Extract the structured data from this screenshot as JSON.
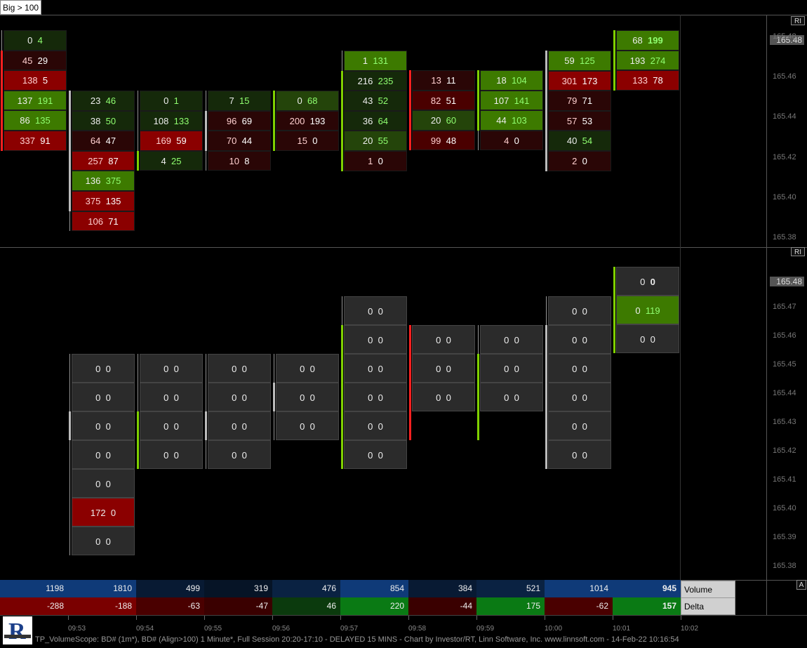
{
  "filter_tag": "Big > 100",
  "top_axis": {
    "ticks": [
      "165.48",
      "165.46",
      "165.44",
      "165.42",
      "165.40",
      "165.38"
    ],
    "ri_label": "RI",
    "price_label": "165.48"
  },
  "bottom_axis": {
    "ticks": [
      "165.47",
      "165.46",
      "165.45",
      "165.44",
      "165.43",
      "165.42",
      "165.41",
      "165.40",
      "165.39",
      "165.38"
    ],
    "ri_label": "RI",
    "price_label": "165.48"
  },
  "top_bars": [
    {
      "time": "09:53",
      "cells": [
        [
          "0",
          "4"
        ],
        [
          "45",
          "29"
        ],
        [
          "138",
          "5"
        ],
        [
          "137",
          "191"
        ],
        [
          "86",
          "135"
        ],
        [
          "337",
          "91"
        ]
      ]
    },
    {
      "time": "09:54",
      "cells": [
        [
          "23",
          "46"
        ],
        [
          "38",
          "50"
        ],
        [
          "64",
          "47"
        ],
        [
          "257",
          "87"
        ],
        [
          "136",
          "375"
        ],
        [
          "375",
          "135"
        ],
        [
          "106",
          "71"
        ]
      ]
    },
    {
      "time": "09:55",
      "cells": [
        [
          "0",
          "1"
        ],
        [
          "108",
          "133"
        ],
        [
          "169",
          "59"
        ],
        [
          "4",
          "25"
        ]
      ]
    },
    {
      "time": "09:56",
      "cells": [
        [
          "7",
          "15"
        ],
        [
          "96",
          "69"
        ],
        [
          "70",
          "44"
        ],
        [
          "10",
          "8"
        ]
      ]
    },
    {
      "time": "09:57",
      "cells": [
        [
          "0",
          "68"
        ],
        [
          "200",
          "193"
        ],
        [
          "15",
          "0"
        ]
      ]
    },
    {
      "time": "09:58",
      "cells": [
        [
          "1",
          "131"
        ],
        [
          "216",
          "235"
        ],
        [
          "43",
          "52"
        ],
        [
          "36",
          "64"
        ],
        [
          "20",
          "55"
        ],
        [
          "1",
          "0"
        ]
      ]
    },
    {
      "time": "09:59",
      "cells": [
        [
          "13",
          "11"
        ],
        [
          "82",
          "51"
        ],
        [
          "20",
          "60"
        ],
        [
          "99",
          "48"
        ]
      ]
    },
    {
      "time": "10:00",
      "cells": [
        [
          "18",
          "104"
        ],
        [
          "107",
          "141"
        ],
        [
          "44",
          "103"
        ],
        [
          "4",
          "0"
        ]
      ]
    },
    {
      "time": "10:01",
      "cells": [
        [
          "59",
          "125"
        ],
        [
          "301",
          "173"
        ],
        [
          "79",
          "71"
        ],
        [
          "57",
          "53"
        ],
        [
          "40",
          "54"
        ],
        [
          "2",
          "0"
        ]
      ]
    },
    {
      "time": "10:02",
      "cells": [
        [
          "68",
          "199"
        ],
        [
          "193",
          "274"
        ],
        [
          "133",
          "78"
        ]
      ]
    }
  ],
  "bottom_bars": [
    {
      "cells": [
        [
          "0",
          "0"
        ],
        [
          "0",
          "0"
        ],
        [
          "0",
          "0"
        ],
        [
          "0",
          "0"
        ],
        [
          "0",
          "0"
        ],
        [
          "172",
          "0"
        ],
        [
          "0",
          "0"
        ]
      ]
    },
    {
      "cells": [
        [
          "0",
          "0"
        ],
        [
          "0",
          "0"
        ],
        [
          "0",
          "0"
        ],
        [
          "0",
          "0"
        ]
      ]
    },
    {
      "cells": [
        [
          "0",
          "0"
        ],
        [
          "0",
          "0"
        ],
        [
          "0",
          "0"
        ],
        [
          "0",
          "0"
        ]
      ]
    },
    {
      "cells": [
        [
          "0",
          "0"
        ],
        [
          "0",
          "0"
        ],
        [
          "0",
          "0"
        ]
      ]
    },
    {
      "cells": [
        [
          "0",
          "0"
        ],
        [
          "0",
          "0"
        ],
        [
          "0",
          "0"
        ],
        [
          "0",
          "0"
        ],
        [
          "0",
          "0"
        ],
        [
          "0",
          "0"
        ]
      ]
    },
    {
      "cells": [
        [
          "0",
          "0"
        ],
        [
          "0",
          "0"
        ],
        [
          "0",
          "0"
        ]
      ]
    },
    {
      "cells": [
        [
          "0",
          "0"
        ],
        [
          "0",
          "0"
        ],
        [
          "0",
          "0"
        ]
      ]
    },
    {
      "cells": [
        [
          "0",
          "0"
        ],
        [
          "0",
          "0"
        ],
        [
          "0",
          "0"
        ],
        [
          "0",
          "0"
        ],
        [
          "0",
          "0"
        ],
        [
          "0",
          "0"
        ]
      ]
    },
    {
      "cells": [
        [
          "0",
          "0"
        ],
        [
          "0",
          "119"
        ],
        [
          "0",
          "0"
        ]
      ]
    }
  ],
  "stats": {
    "volume_label": "Volume",
    "delta_label": "Delta",
    "volume": [
      "1198",
      "1810",
      "499",
      "319",
      "476",
      "854",
      "384",
      "521",
      "1014",
      "945"
    ],
    "delta": [
      "-288",
      "-188",
      "-63",
      "-47",
      "46",
      "220",
      "-44",
      "175",
      "-62",
      "157"
    ]
  },
  "x_ticks": [
    "09:53",
    "09:54",
    "09:55",
    "09:56",
    "09:57",
    "09:58",
    "09:59",
    "10:00",
    "10:01",
    "10:02"
  ],
  "a_label": "A",
  "footer": "TP_VolumeScope: BD# (1m*), BD# (Align>100) 1 Minute*, Full Session 20:20-17:10 - DELAYED 15 MINS - Chart by Investor/RT, Linn Software, Inc. www.linnsoft.com - 14-Feb-22 10:16:54",
  "colors": {
    "bid_dark": "#3a0000",
    "bid_red": "#8b0000",
    "ask_green": "#3f7a00",
    "neutral": "#2b2b2b"
  }
}
